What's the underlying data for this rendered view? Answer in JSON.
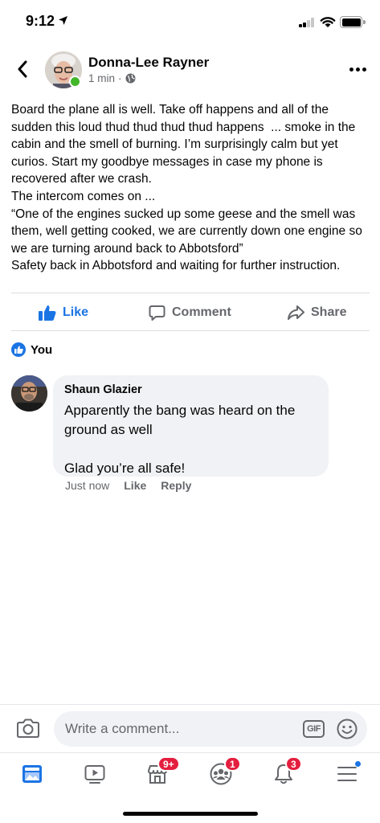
{
  "status_bar": {
    "time": "9:12"
  },
  "post": {
    "author": "Donna-Lee Rayner",
    "timestamp": "1 min",
    "separator": "·",
    "text": "Board the plane all is well. Take off happens and all of the sudden this loud thud thud thud thud happens  ... smoke in the cabin and the smell of burning. I’m surprisingly calm but yet curios. Start my goodbye messages in case my phone is recovered after we crash.\nThe intercom comes on ...\n“One of the engines sucked up some geese and the smell was them, well getting cooked, we are currently down one engine so we are turning around back to Abbotsford”\nSafety back in Abbotsford and waiting for further instruction."
  },
  "actions": {
    "like": "Like",
    "comment": "Comment",
    "share": "Share"
  },
  "reactions": {
    "label": "You"
  },
  "comment": {
    "author": "Shaun Glazier",
    "text": "Apparently the bang was heard on the ground as well\n\nGlad you’re all safe!",
    "time": "Just now",
    "like": "Like",
    "reply": "Reply"
  },
  "composer": {
    "placeholder": "Write a comment...",
    "gif": "GIF"
  },
  "tab_bar": {
    "badges": {
      "marketplace": "9+",
      "groups": "1",
      "notifications": "3"
    }
  },
  "colors": {
    "facebook_blue": "#1b74e4",
    "badge_red": "#e41e3f",
    "online_green": "#42b72a",
    "secondary_text": "#65676b"
  }
}
